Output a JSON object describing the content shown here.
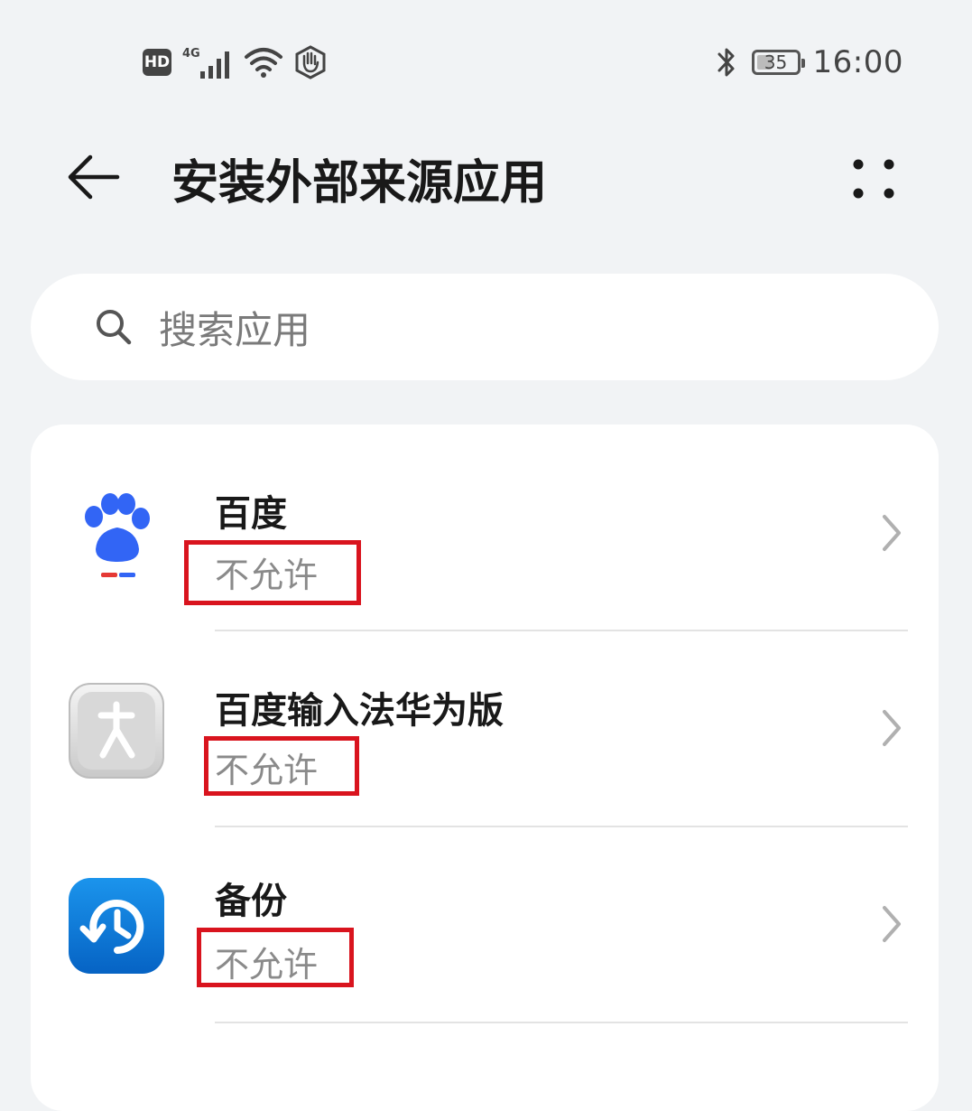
{
  "status_bar": {
    "hd_label": "HD",
    "network_label": "4G",
    "battery_level": "35",
    "battery_fraction": 0.35,
    "time": "16:00",
    "icons": [
      "hd-icon",
      "signal-4g-icon",
      "wifi-icon",
      "hand-icon",
      "bluetooth-icon",
      "battery-icon"
    ]
  },
  "header": {
    "title": "安装外部来源应用",
    "back_icon": "arrow-left-icon",
    "more_icon": "more-dots-icon"
  },
  "search": {
    "placeholder": "搜索应用",
    "icon": "search-icon"
  },
  "apps": [
    {
      "name": "百度",
      "status": "不允许",
      "icon": "baidu-paw-icon"
    },
    {
      "name": "百度输入法华为版",
      "status": "不允许",
      "icon": "baidu-input-icon"
    },
    {
      "name": "备份",
      "status": "不允许",
      "icon": "backup-icon"
    }
  ],
  "colors": {
    "background": "#f1f3f5",
    "card": "#ffffff",
    "highlight": "#d9141e",
    "status_text": "#8a8a8a",
    "baidu_blue": "#3265f5",
    "backup_blue": "#0b7ad4"
  }
}
